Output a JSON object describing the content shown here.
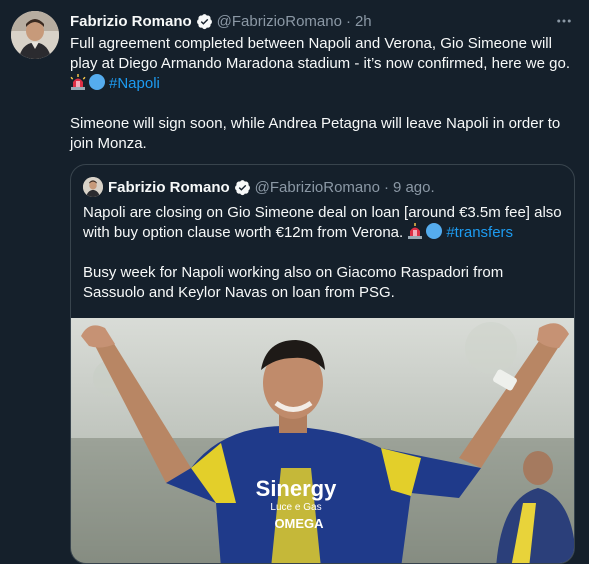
{
  "tweet": {
    "author_name": "Fabrizio Romano",
    "author_handle": "@FabrizioRomano",
    "separator": "·",
    "time": "2h",
    "text_line1": "Full agreement completed between Napoli and Verona, Gio Simeone will play at Diego Armando Maradona stadium - it’s now confirmed, here we go.",
    "hashtag": "#Napoli",
    "text_para2": "Simeone will sign soon, while Andrea Petagna will leave Napoli in order to join Monza.",
    "icons": [
      "verified-badge",
      "more-icon",
      "siren-emoji",
      "blue-circle-emoji"
    ]
  },
  "quoted": {
    "author_name": "Fabrizio Romano",
    "author_handle": "@FabrizioRomano",
    "separator": "·",
    "time": "9 ago.",
    "text_para1": "Napoli are closing on Gio Simeone deal on loan [around €3.5m fee] also with buy option clause worth €12m from Verona.",
    "hashtag": "#transfers",
    "text_para2": "Busy week for Napoli working also on Giacomo Raspadori from Sassuolo and Keylor Navas on loan from PSG.",
    "photo": {
      "shirt_sponsor": "Sinergy",
      "shirt_sponsor_sub": "Luce e Gas",
      "shirt_brand": "OMEGA"
    }
  },
  "colors": {
    "background": "#15202b",
    "text": "#f7f9f9",
    "secondary": "#8b98a5",
    "link": "#1d9bf0",
    "border": "#38444d",
    "verified": "#1d9bf0"
  }
}
